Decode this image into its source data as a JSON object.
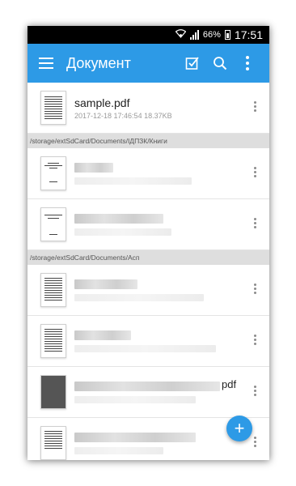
{
  "status_bar": {
    "battery": "66%",
    "time": "17:51"
  },
  "app_bar": {
    "title": "Документ"
  },
  "files_top": [
    {
      "name": "sample.pdf",
      "meta": "2017-12-18 17:46:54 18.37KB"
    }
  ],
  "sections": [
    {
      "path": "/storage/extSdCard/Documents/ІДПЗК/Книги"
    },
    {
      "path": "/storage/extSdCard/Documents/Асп"
    }
  ],
  "partial_suffix": "pdf",
  "fab_label": "+",
  "colors": {
    "accent": "#2d9ae6",
    "section_bg": "#dedede"
  }
}
